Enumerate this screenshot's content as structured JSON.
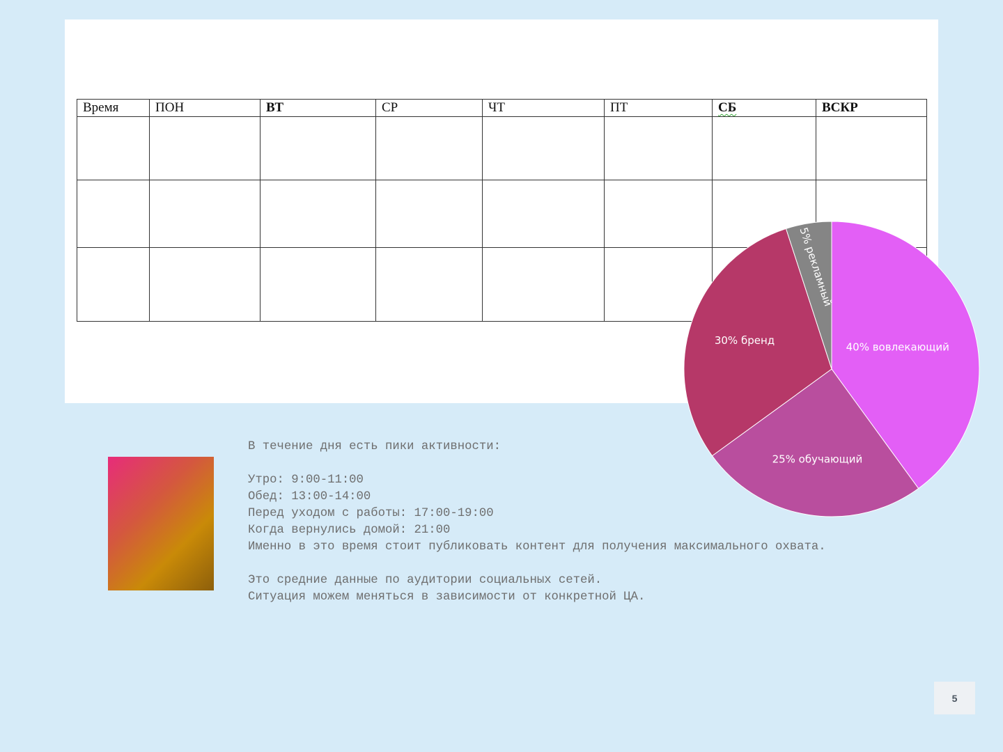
{
  "schedule": {
    "headers": [
      "Время",
      "ПОН",
      "ВТ",
      "СР",
      "ЧТ",
      "ПТ",
      "СБ",
      "ВСКР"
    ],
    "rows": [
      [
        "",
        "",
        "",
        "",
        "",
        "",
        "",
        ""
      ],
      [
        "",
        "",
        "",
        "",
        "",
        "",
        "",
        ""
      ],
      [
        "",
        "",
        "",
        "",
        "",
        "",
        "",
        ""
      ]
    ]
  },
  "chart_data": {
    "type": "pie",
    "title": "",
    "slices": [
      {
        "label": "40% вовлекающий",
        "value": 40,
        "color": "#e35ff6"
      },
      {
        "label": "25% обучающий",
        "value": 25,
        "color": "#b94e9e"
      },
      {
        "label": "30% бренд",
        "value": 30,
        "color": "#b63868"
      },
      {
        "label": "5% рекламный",
        "value": 5,
        "color": "#858585"
      }
    ],
    "start_angle_deg": 0,
    "direction": "clockwise",
    "legend": "none"
  },
  "notes": {
    "lines": [
      "В течение дня есть пики активности:",
      "",
      "Утро: 9:00-11:00",
      "Обед: 13:00-14:00",
      "Перед уходом с работы: 17:00-19:00",
      "Когда вернулись домой: 21:00",
      "Именно в это время стоит публиковать контент для получения максимального охвата.",
      "",
      "Это средние данные по аудитории социальных сетей.",
      "Ситуация можем меняться в зависимости от конкретной ЦА."
    ]
  },
  "colors": {
    "background": "#d6ebf8",
    "sheet": "#ffffff",
    "gradient_start": "#e72c7a",
    "gradient_mid": "#c98a08",
    "gradient_end": "#8d5f0b"
  },
  "page_number": "5"
}
